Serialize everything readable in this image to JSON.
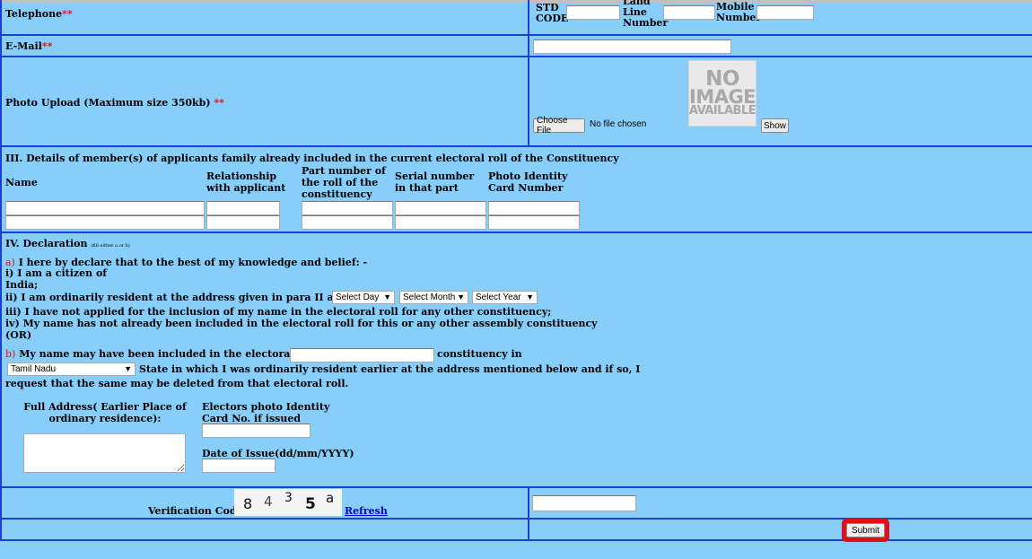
{
  "telephone": {
    "label": "Telephone",
    "required_mark": "**",
    "std_code_label": "STD CODE",
    "landline_label": "Land Line Number",
    "mobile_label": "Mobile Number",
    "std_code_value": "",
    "landline_value": "",
    "mobile_value": ""
  },
  "email": {
    "label": "E-Mail",
    "required_mark": "**",
    "value": ""
  },
  "photo_upload": {
    "label": "Photo Upload (Maximum size 350kb)",
    "required_mark": "**",
    "placeholder_text": {
      "line1": "NO",
      "line2": "IMAGE",
      "line3": "AVAILABLE"
    },
    "choose_file_label": "Choose File",
    "file_status": "No file chosen",
    "show_label": "Show"
  },
  "family_section": {
    "heading": "III. Details of member(s) of applicants family already included in the current electoral roll of the Constituency",
    "columns": [
      "Name",
      "Relationship with applicant",
      "Part number of the roll of the constituency",
      "Serial number in that part",
      "Photo Identity Card Number"
    ],
    "rows": [
      [
        "",
        "",
        "",
        "",
        ""
      ],
      [
        "",
        "",
        "",
        "",
        ""
      ]
    ]
  },
  "declaration": {
    "heading": "IV. Declaration",
    "heading_note": "(fill either a or b)",
    "a_marker": "a)",
    "a_intro": "I here by declare that to the best of my knowledge and belief: -",
    "item1": "i) I am a citizen of",
    "item1_cont": "India;",
    "item2": "ii) I am ordinarily resident at the address given in para II above since",
    "select_day": "Select Day",
    "select_month": "Select Month",
    "select_year": "Select Year",
    "item3": "iii) I have not applied for the inclusion of my name in the electoral roll for any other constituency;",
    "item4": "iv) My name has not already been included in the electoral roll for this or any other assembly constituency",
    "or": "(OR)",
    "b_marker": "b)",
    "b_text": "My name may have been included in the electoral roll for",
    "b_constituency_value": "",
    "b_text2": "constituency in",
    "state_selected": "Tamil Nadu",
    "b_text3": "State in which I was ordinarily resident earlier at the address mentioned below and if so, I",
    "b_text4": "request that the same may be deleted from that electoral roll.",
    "full_address_label": "Full Address( Earlier Place of ordinary residence):",
    "epic_label": "Electors photo Identity Card No. if issued",
    "date_issue_label": "Date of Issue(dd/mm/YYYY)"
  },
  "verification": {
    "label": "Verification Code",
    "captcha": [
      "8",
      "4",
      "3",
      "5",
      "a"
    ],
    "refresh_label": "Refresh",
    "value": ""
  },
  "submit": {
    "label": "Submit",
    "highlight_color": "#e0101a"
  },
  "colors": {
    "background": "#87cefa",
    "border": "#1a3fd6",
    "required": "#e01010"
  }
}
